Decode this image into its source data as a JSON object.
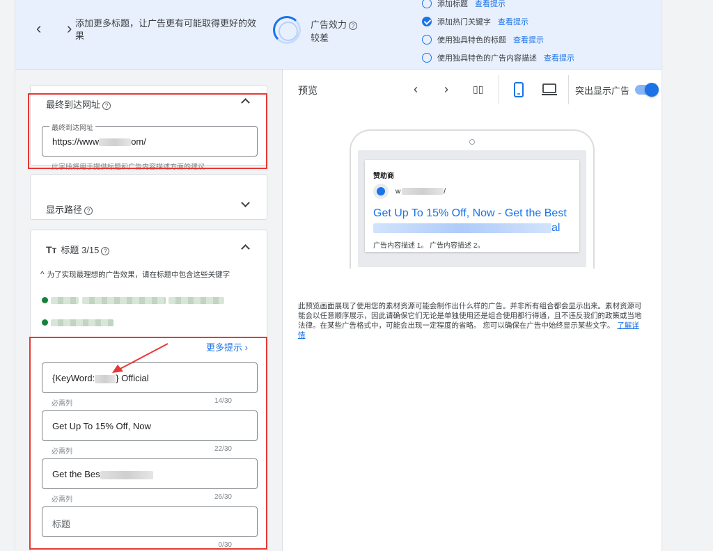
{
  "banner": {
    "tip": "添加更多标题，让广告更有可能取得更好的效果",
    "effectiveness_title": "广告效力",
    "effectiveness_value": "较差",
    "checklist": [
      {
        "label": "添加标题",
        "link": "查看提示",
        "done": false
      },
      {
        "label": "添加热门关键字",
        "link": "查看提示",
        "done": true
      },
      {
        "label": "使用独具特色的标题",
        "link": "查看提示",
        "done": false
      },
      {
        "label": "使用独具特色的广告内容描述",
        "link": "查看提示",
        "done": false
      }
    ]
  },
  "final_url": {
    "title": "最终到达网址",
    "field_label": "最终到达网址",
    "value_prefix": "https://www",
    "value_suffix": "om/",
    "hint": "此字段将用于提供标题和广告内容描述方面的建议"
  },
  "display_path": {
    "title": "显示路径"
  },
  "headlines": {
    "icon": "Tт",
    "title": "标题 3/15",
    "suggestion": "为了实现最理想的广告效果，请在标题中包含这些关键字",
    "more_tips": "更多提示",
    "items": [
      {
        "value_a": "{KeyWord:",
        "value_b": "} Official",
        "hint": "必需列",
        "count": "14/30"
      },
      {
        "value_a": "Get Up To 15% Off, Now",
        "value_b": "",
        "hint": "必需列",
        "count": "22/30"
      },
      {
        "value_a": "Get the Bes",
        "value_b": "",
        "hint": "必需列",
        "count": "26/30"
      },
      {
        "value_a": "标题",
        "value_b": "",
        "hint": "",
        "count": "0/30"
      }
    ]
  },
  "preview": {
    "label": "预览",
    "highlight_label": "突出显示广告",
    "highlight_on": true,
    "ad": {
      "sponsor": "赞助商",
      "url_prefix": "w",
      "url_suffix": "/",
      "headline_line1": "Get Up To 15% Off, Now - Get the Best",
      "headline_line2_suffix": "al",
      "description": "广告内容描述 1。 广告内容描述 2。"
    },
    "disclaimer": "此预览画面展现了使用您的素材资源可能会制作出什么样的广告。并非所有组合都会显示出来。素材资源可能会以任意顺序展示，因此请确保它们无论是单独使用还是组合使用都行得通，且不违反我们的政策或当地法律。在某些广告格式中，可能会出现一定程度的省略。 您可以确保在广告中始终显示某些文字。",
    "learn_more": "了解详情"
  }
}
